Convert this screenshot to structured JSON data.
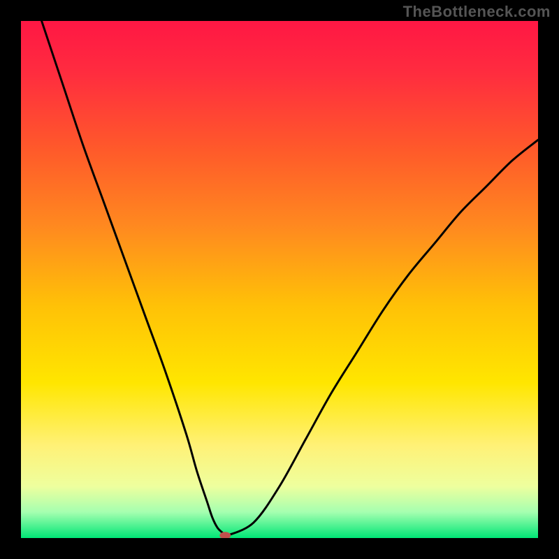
{
  "watermark": "TheBottleneck.com",
  "chart_data": {
    "type": "line",
    "title": "",
    "xlabel": "",
    "ylabel": "",
    "xlim": [
      0,
      100
    ],
    "ylim": [
      0,
      100
    ],
    "grid": false,
    "legend": false,
    "background_gradient": {
      "stops": [
        {
          "offset": 0.0,
          "color": "#ff1744"
        },
        {
          "offset": 0.1,
          "color": "#ff2c3f"
        },
        {
          "offset": 0.25,
          "color": "#ff5a2a"
        },
        {
          "offset": 0.4,
          "color": "#ff8a1f"
        },
        {
          "offset": 0.55,
          "color": "#ffc107"
        },
        {
          "offset": 0.7,
          "color": "#ffe600"
        },
        {
          "offset": 0.82,
          "color": "#fff176"
        },
        {
          "offset": 0.9,
          "color": "#eeff9e"
        },
        {
          "offset": 0.95,
          "color": "#a5ffb0"
        },
        {
          "offset": 1.0,
          "color": "#00e676"
        }
      ]
    },
    "series": [
      {
        "name": "curve",
        "color": "#000000",
        "x": [
          4,
          8,
          12,
          16,
          20,
          24,
          28,
          32,
          34,
          36,
          37,
          38,
          39,
          39.5,
          40,
          45,
          50,
          55,
          60,
          65,
          70,
          75,
          80,
          85,
          90,
          95,
          100
        ],
        "y": [
          100,
          88,
          76,
          65,
          54,
          43,
          32,
          20,
          13,
          7,
          4,
          2,
          1,
          0.5,
          0.5,
          3,
          10,
          19,
          28,
          36,
          44,
          51,
          57,
          63,
          68,
          73,
          77
        ]
      }
    ],
    "marker": {
      "x": 39.5,
      "y": 0.5,
      "color": "#c0504d",
      "rx": 8,
      "ry": 5
    }
  }
}
